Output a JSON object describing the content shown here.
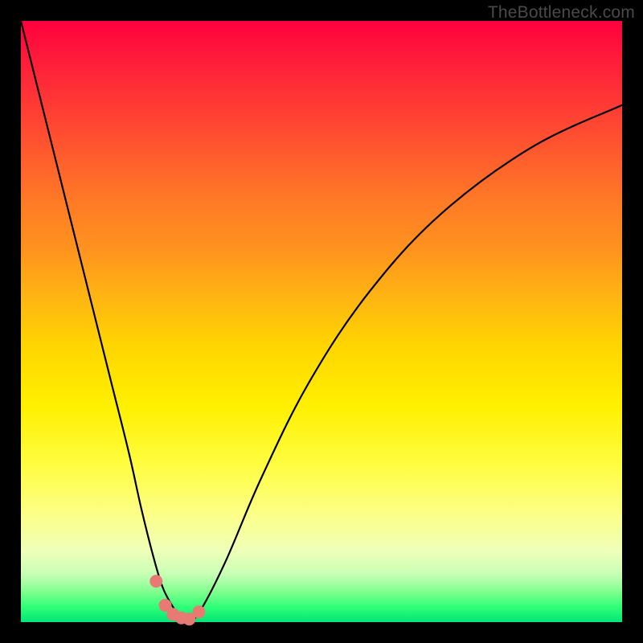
{
  "watermark": "TheBottleneck.com",
  "chart_data": {
    "type": "line",
    "title": "",
    "xlabel": "",
    "ylabel": "",
    "xlim": [
      0,
      100
    ],
    "ylim": [
      0,
      100
    ],
    "grid": false,
    "legend": false,
    "series": [
      {
        "name": "bottleneck-curve",
        "x": [
          0,
          3,
          6,
          9,
          12,
          15,
          18,
          20,
          22,
          23.5,
          25,
          26.5,
          28,
          29.6,
          34,
          40,
          48,
          58,
          70,
          85,
          100
        ],
        "y": [
          100,
          88,
          76,
          64,
          52,
          40,
          28,
          19,
          11,
          6,
          3,
          1,
          0.5,
          1.5,
          10,
          24,
          40,
          55,
          68,
          79,
          86
        ]
      }
    ],
    "markers": {
      "name": "bottleneck-markers",
      "x": [
        22.5,
        24.0,
        25.3,
        26.7,
        28.0,
        29.6
      ],
      "y": [
        6.8,
        2.8,
        1.3,
        0.7,
        0.5,
        1.7
      ]
    },
    "colors": {
      "curve": "#000000",
      "marker": "#e77b73",
      "gradient_top": "#ff003f",
      "gradient_bottom": "#00e676"
    }
  }
}
